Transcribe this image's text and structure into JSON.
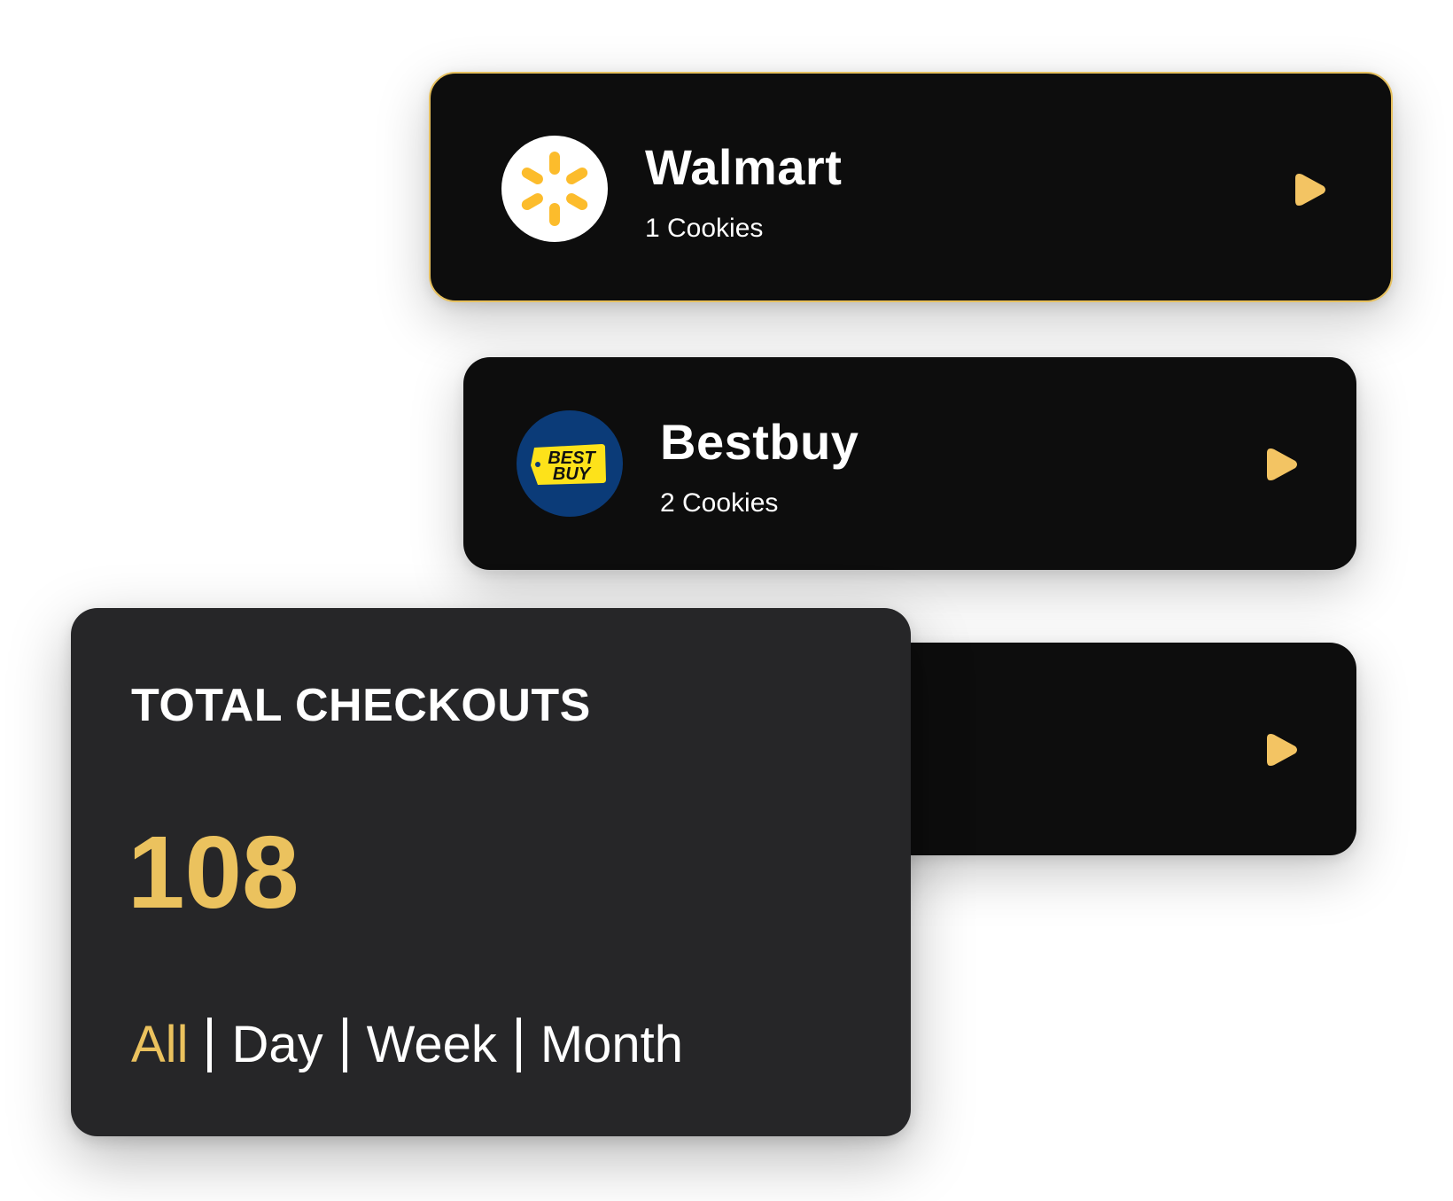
{
  "stores": [
    {
      "name": "Walmart",
      "cookies": "1 Cookies",
      "logo_icon": "walmart-spark-icon",
      "logo_bg": "#ffffff",
      "logo_color": "#fcbc2c",
      "selected": true
    },
    {
      "name": "Bestbuy",
      "cookies": "2 Cookies",
      "logo_icon": "bestbuy-tag-icon",
      "logo_bg": "#0b3b78",
      "logo_color": "#fde21a",
      "logo_text": [
        "BEST",
        "BUY"
      ],
      "selected": false
    },
    {
      "name": "",
      "cookies": "",
      "selected": false
    }
  ],
  "play_icon": "play-icon",
  "stats": {
    "title": "TOTAL CHECKOUTS",
    "value": "108",
    "filters": [
      {
        "label": "All",
        "active": true
      },
      {
        "label": "Day",
        "active": false
      },
      {
        "label": "Week",
        "active": false
      },
      {
        "label": "Month",
        "active": false
      }
    ]
  },
  "colors": {
    "accent": "#ebc25e",
    "card_bg": "#0d0d0d",
    "stats_bg": "#262628",
    "text": "#ffffff"
  }
}
